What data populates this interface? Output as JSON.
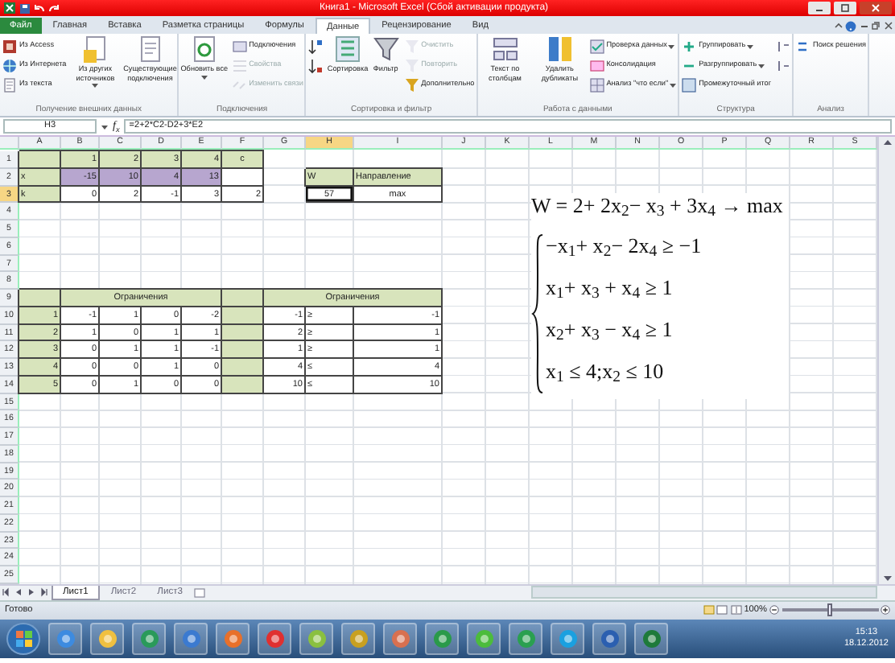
{
  "window": {
    "title": "Книга1 - Microsoft Excel (Сбой активации продукта)"
  },
  "ribbon_tabs": [
    {
      "label": "Файл",
      "kind": "file",
      "selected": false
    },
    {
      "label": "Главная",
      "kind": "tab",
      "selected": false
    },
    {
      "label": "Вставка",
      "kind": "tab",
      "selected": false
    },
    {
      "label": "Разметка страницы",
      "kind": "tab",
      "selected": false
    },
    {
      "label": "Формулы",
      "kind": "tab",
      "selected": false
    },
    {
      "label": "Данные",
      "kind": "tab",
      "selected": true
    },
    {
      "label": "Рецензирование",
      "kind": "tab",
      "selected": false
    },
    {
      "label": "Вид",
      "kind": "tab",
      "selected": false
    }
  ],
  "ribbon_groups": [
    {
      "label": "Получение внешних данных",
      "items": [
        {
          "label": "Из Access",
          "kind": "small",
          "disabled": false,
          "dropdown": false
        },
        {
          "label": "Из Интернета",
          "kind": "small",
          "disabled": false,
          "dropdown": false
        },
        {
          "label": "Из текста",
          "kind": "small",
          "disabled": false,
          "dropdown": false
        },
        {
          "label": "Из других источников",
          "kind": "large",
          "disabled": false,
          "dropdown": true
        },
        {
          "label": "Существующие подключения",
          "kind": "large",
          "disabled": false,
          "dropdown": false
        }
      ]
    },
    {
      "label": "Подключения",
      "items": [
        {
          "label": "Обновить все",
          "kind": "large",
          "disabled": false,
          "dropdown": true
        },
        {
          "label": "Подключения",
          "kind": "small",
          "disabled": false,
          "dropdown": false
        },
        {
          "label": "Свойства",
          "kind": "small",
          "disabled": true,
          "dropdown": false
        },
        {
          "label": "Изменить связи",
          "kind": "small",
          "disabled": true,
          "dropdown": false
        }
      ]
    },
    {
      "label": "Сортировка и фильтр",
      "items": [
        {
          "kind": "small",
          "disabled": false,
          "dropdown": false
        },
        {
          "kind": "small",
          "disabled": false,
          "dropdown": false
        },
        {
          "label": "Сортировка",
          "kind": "large",
          "disabled": false,
          "dropdown": false
        },
        {
          "label": "Фильтр",
          "kind": "large",
          "disabled": false,
          "dropdown": false
        },
        {
          "label": "Очистить",
          "kind": "small",
          "disabled": true,
          "dropdown": false
        },
        {
          "label": "Повторить",
          "kind": "small",
          "disabled": true,
          "dropdown": false
        },
        {
          "label": "Дополнительно",
          "kind": "small",
          "disabled": false,
          "dropdown": false
        }
      ]
    },
    {
      "label": "Работа с данными",
      "items": [
        {
          "label": "Текст по столбцам",
          "kind": "large",
          "disabled": false,
          "dropdown": false
        },
        {
          "label": "Удалить дубликаты",
          "kind": "large",
          "disabled": false,
          "dropdown": false
        },
        {
          "label": "Проверка данных",
          "kind": "small",
          "disabled": false,
          "dropdown": true
        },
        {
          "label": "Консолидация",
          "kind": "small",
          "disabled": false,
          "dropdown": false
        },
        {
          "label": "Анализ \"что если\"",
          "kind": "small",
          "disabled": false,
          "dropdown": true
        }
      ]
    },
    {
      "label": "Структура",
      "items": [
        {
          "label": "Группировать",
          "kind": "small",
          "disabled": false,
          "dropdown": true
        },
        {
          "label": "Разгруппировать",
          "kind": "small",
          "disabled": false,
          "dropdown": true
        },
        {
          "label": "Промежуточный итог",
          "kind": "small",
          "disabled": false,
          "dropdown": false
        },
        {
          "kind": "small",
          "disabled": false,
          "dropdown": false
        },
        {
          "kind": "small",
          "disabled": false,
          "dropdown": false
        }
      ]
    },
    {
      "label": "Анализ",
      "items": [
        {
          "label": "Поиск решения",
          "kind": "small",
          "disabled": false,
          "dropdown": false
        }
      ]
    }
  ],
  "formula_bar": {
    "name_box": "H3",
    "function_label": "f$_{x}$",
    "formula": "=2+2*C2-D2+3*E2"
  },
  "sheet": {
    "columns": [
      {
        "label": "A",
        "selected": false
      },
      {
        "label": "B",
        "selected": false
      },
      {
        "label": "C",
        "selected": false
      },
      {
        "label": "D",
        "selected": false
      },
      {
        "label": "E",
        "selected": false
      },
      {
        "label": "F",
        "selected": false
      },
      {
        "label": "G",
        "selected": false
      },
      {
        "label": "H",
        "selected": true
      },
      {
        "label": "I",
        "selected": false
      },
      {
        "label": "J",
        "selected": false
      },
      {
        "label": "K",
        "selected": false
      },
      {
        "label": "L",
        "selected": false
      },
      {
        "label": "M",
        "selected": false
      },
      {
        "label": "N",
        "selected": false
      },
      {
        "label": "O",
        "selected": false
      },
      {
        "label": "P",
        "selected": false
      },
      {
        "label": "Q",
        "selected": false
      },
      {
        "label": "R",
        "selected": false
      },
      {
        "label": "S",
        "selected": false
      }
    ],
    "rows": [
      {
        "label": "1",
        "selected": false,
        "cells": [
          {
            "kind": "label",
            "selected": false
          },
          {
            "text": "1",
            "kind": "label",
            "selected": false
          },
          {
            "text": "2",
            "kind": "label",
            "selected": false
          },
          {
            "text": "3",
            "kind": "label",
            "selected": false
          },
          {
            "text": "4",
            "kind": "label",
            "selected": false
          },
          {
            "text": "c",
            "kind": "label-centered",
            "selected": false
          }
        ]
      },
      {
        "label": "2",
        "selected": false,
        "cells": [
          {
            "text": "x",
            "kind": "label-text",
            "selected": false
          },
          {
            "text": "-15",
            "kind": "variable",
            "selected": false
          },
          {
            "text": "10",
            "kind": "variable",
            "selected": false
          },
          {
            "text": "4",
            "kind": "variable",
            "selected": false
          },
          {
            "text": "13",
            "kind": "variable",
            "selected": false
          },
          {
            "kind": "value",
            "selected": false
          },
          {},
          {
            "text": "W",
            "kind": "label-text",
            "selected": false
          },
          {
            "text": "Направление",
            "kind": "label-text",
            "selected": false
          }
        ]
      },
      {
        "label": "3",
        "selected": true,
        "cells": [
          {
            "text": "k",
            "kind": "label-text",
            "selected": false
          },
          {
            "text": "0",
            "kind": "value",
            "selected": false
          },
          {
            "text": "2",
            "kind": "value",
            "selected": false
          },
          {
            "text": "-1",
            "kind": "value",
            "selected": false
          },
          {
            "text": "3",
            "kind": "value",
            "selected": false
          },
          {
            "text": "2",
            "kind": "value",
            "selected": false
          },
          {},
          {
            "text": "57",
            "kind": "value-centered",
            "selected": true
          },
          {
            "text": "max",
            "kind": "value-centered",
            "selected": false
          }
        ]
      },
      {
        "label": "4",
        "selected": false
      },
      {
        "label": "5",
        "selected": false
      },
      {
        "label": "6",
        "selected": false
      },
      {
        "label": "7",
        "selected": false
      },
      {
        "label": "8",
        "selected": false
      },
      {
        "label": "9",
        "selected": false,
        "cells": [
          {
            "kind": "label",
            "selected": false
          },
          {
            "text": "Ограничения",
            "kind": "label-centered",
            "selected": false
          },
          {
            "kind": "merged"
          },
          {
            "kind": "merged"
          },
          {
            "kind": "merged"
          },
          {
            "kind": "label",
            "selected": false
          },
          {
            "text": "Ограничения",
            "kind": "label-centered",
            "selected": false
          },
          {
            "kind": "merged"
          },
          {
            "kind": "merged"
          }
        ]
      },
      {
        "label": "10",
        "selected": false,
        "cells": [
          {
            "text": "1",
            "kind": "label",
            "selected": false
          },
          {
            "text": "-1",
            "kind": "value",
            "selected": false
          },
          {
            "text": "1",
            "kind": "value",
            "selected": false
          },
          {
            "text": "0",
            "kind": "value",
            "selected": false
          },
          {
            "text": "-2",
            "kind": "value",
            "selected": false
          },
          {
            "kind": "label",
            "selected": false
          },
          {
            "text": "-1",
            "kind": "value",
            "selected": false
          },
          {
            "text": "≥",
            "kind": "value-text",
            "selected": false
          },
          {
            "text": "-1",
            "kind": "value",
            "selected": false
          }
        ]
      },
      {
        "label": "11",
        "selected": false,
        "cells": [
          {
            "text": "2",
            "kind": "label",
            "selected": false
          },
          {
            "text": "1",
            "kind": "value",
            "selected": false
          },
          {
            "text": "0",
            "kind": "value",
            "selected": false
          },
          {
            "text": "1",
            "kind": "value",
            "selected": false
          },
          {
            "text": "1",
            "kind": "value",
            "selected": false
          },
          {
            "kind": "label",
            "selected": false
          },
          {
            "text": "2",
            "kind": "value",
            "selected": false
          },
          {
            "text": "≥",
            "kind": "value-text",
            "selected": false
          },
          {
            "text": "1",
            "kind": "value",
            "selected": false
          }
        ]
      },
      {
        "label": "12",
        "selected": false,
        "cells": [
          {
            "text": "3",
            "kind": "label",
            "selected": false
          },
          {
            "text": "0",
            "kind": "value",
            "selected": false
          },
          {
            "text": "1",
            "kind": "value",
            "selected": false
          },
          {
            "text": "1",
            "kind": "value",
            "selected": false
          },
          {
            "text": "-1",
            "kind": "value",
            "selected": false
          },
          {
            "kind": "label",
            "selected": false
          },
          {
            "text": "1",
            "kind": "value",
            "selected": false
          },
          {
            "text": "≥",
            "kind": "value-text",
            "selected": false
          },
          {
            "text": "1",
            "kind": "value",
            "selected": false
          }
        ]
      },
      {
        "label": "13",
        "selected": false,
        "cells": [
          {
            "text": "4",
            "kind": "label",
            "selected": false
          },
          {
            "text": "0",
            "kind": "value",
            "selected": false
          },
          {
            "text": "0",
            "kind": "value",
            "selected": false
          },
          {
            "text": "1",
            "kind": "value",
            "selected": false
          },
          {
            "text": "0",
            "kind": "value",
            "selected": false
          },
          {
            "kind": "label",
            "selected": false
          },
          {
            "text": "4",
            "kind": "value",
            "selected": false
          },
          {
            "text": "≤",
            "kind": "value-text",
            "selected": false
          },
          {
            "text": "4",
            "kind": "value",
            "selected": false
          }
        ]
      },
      {
        "label": "14",
        "selected": false,
        "cells": [
          {
            "text": "5",
            "kind": "label",
            "selected": false
          },
          {
            "text": "0",
            "kind": "value",
            "selected": false
          },
          {
            "text": "1",
            "kind": "value",
            "selected": false
          },
          {
            "text": "0",
            "kind": "value",
            "selected": false
          },
          {
            "text": "0",
            "kind": "value",
            "selected": false
          },
          {
            "kind": "label",
            "selected": false
          },
          {
            "text": "10",
            "kind": "value",
            "selected": false
          },
          {
            "text": "≤",
            "kind": "value-text",
            "selected": false
          },
          {
            "text": "10",
            "kind": "value",
            "selected": false
          }
        ]
      },
      {
        "label": "15",
        "selected": false
      },
      {
        "label": "16",
        "selected": false
      },
      {
        "label": "17",
        "selected": false
      },
      {
        "label": "18",
        "selected": false
      },
      {
        "label": "19",
        "selected": false
      },
      {
        "label": "20",
        "selected": false
      },
      {
        "label": "21",
        "selected": false
      },
      {
        "label": "22",
        "selected": false
      },
      {
        "label": "23",
        "selected": false
      },
      {
        "label": "24",
        "selected": false
      },
      {
        "label": "25",
        "selected": false
      }
    ]
  },
  "equation": {
    "objective": "W = 2+ 2x$_{2}$− x$_{3}$ + 3x$_{4}$ → max",
    "constraints": [
      "−x$_{1}$+ x$_{2}$− 2x$_{4}$ ≥ −1",
      "x$_{1}$+ x$_{3}$ + x$_{4}$ ≥ 1",
      "x$_{2}$+ x$_{3}$ − x$_{4}$ ≥ 1",
      "x$_{1}$ ≤ 4;x$_{2}$ ≤ 10"
    ]
  },
  "sheet_tabs": [
    {
      "label": "Лист1",
      "selected": true
    },
    {
      "label": "Лист2",
      "selected": false
    },
    {
      "label": "Лист3",
      "selected": false
    }
  ],
  "status_bar": {
    "text": "Готово",
    "zoom": "100%",
    "zoom_slider": {
      "level": 0.5
    }
  },
  "taskbar": {
    "time": "15:13",
    "date": "18.12.2012"
  }
}
